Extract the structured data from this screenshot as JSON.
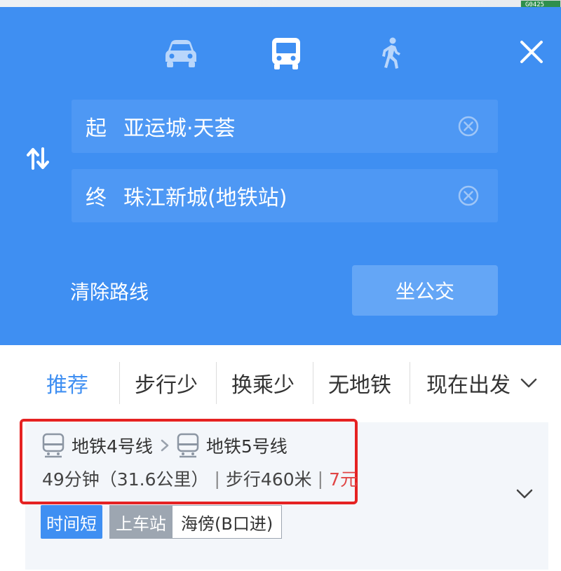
{
  "map": {
    "road_sign": "G0425"
  },
  "modes": [
    {
      "key": "car",
      "icon": "car-icon",
      "active": false
    },
    {
      "key": "bus",
      "icon": "bus-icon",
      "active": true
    },
    {
      "key": "walk",
      "icon": "walk-icon",
      "active": false
    }
  ],
  "colors": {
    "header_blue": "#3f8ff2",
    "field_blue": "#4e98f4",
    "button_blue": "#64a6f6",
    "highlight_red": "#e52222",
    "price_red": "#e04545"
  },
  "route_input": {
    "start_tag": "起",
    "start_value": "亚运城·天荟",
    "end_tag": "终",
    "end_value": "珠江新城(地铁站)"
  },
  "actions": {
    "clear_route": "清除路线",
    "take_bus": "坐公交"
  },
  "tabs": [
    {
      "label": "推荐",
      "active": true
    },
    {
      "label": "步行少",
      "active": false
    },
    {
      "label": "换乘少",
      "active": false
    },
    {
      "label": "无地铁",
      "active": false
    }
  ],
  "depart": {
    "label": "现在出发"
  },
  "route": {
    "line1": "地铁4号线",
    "line2": "地铁5号线",
    "duration": "49分钟（31.6公里）",
    "walk": "步行460米",
    "price": "7元",
    "sep": "|",
    "tag_fast": "时间短",
    "board_label": "上车站",
    "board_value": "海傍(B口进)"
  }
}
